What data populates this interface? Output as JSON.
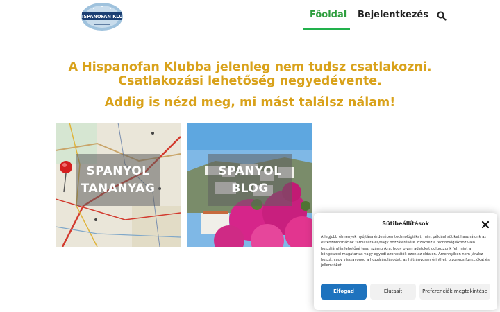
{
  "header": {
    "logo_text": "HISPANOFAN KLUB",
    "nav": {
      "home_label": "Főoldal",
      "login_label": "Bejelentkezés"
    },
    "colors": {
      "nav_active": "#2e9e3e",
      "nav_underline": "#22b14c"
    },
    "search_icon": "search-icon"
  },
  "main": {
    "line1": "A Hispanofan Klubba jelenleg nem tudsz csatlakozni.",
    "line2": "Csatlakozási lehetőség negyedévente.",
    "line3": "Addig is nézd meg, mi mást találsz nálam!",
    "headline_color": "#d9a21b",
    "cards": [
      {
        "title_line1": "SPANYOL",
        "title_line2": "TANANYAG",
        "image": "map-with-red-pin"
      },
      {
        "title_line1": "SPANYOL",
        "title_line2": "BLOG",
        "image": "white-village-with-pink-flowers"
      }
    ]
  },
  "cookie": {
    "title": "Sütibeállítások",
    "text": "A legjobb élmények nyújtása érdekében technológiákat, mint például sütiket használunk az eszközinformációk tárolására és/vagy hozzáférésére. Ezekhez a technológiákhoz való hozzájárulás lehetővé teszi számunkra, hogy olyan adatokat dolgozzunk fel, mint a böngészési magatartás vagy egyedi azonosítók ezen az oldalon. Amennyiben nem járulsz hozzá, vagy visszavonod a hozzájárulásodat, az hátrányosan érintheti bizonyos funkciókat és jellemzőket.",
    "accept_label": "Elfogad",
    "deny_label": "Elutasít",
    "prefs_label": "Preferenciák megtekintése",
    "accent": "#1e73be"
  }
}
